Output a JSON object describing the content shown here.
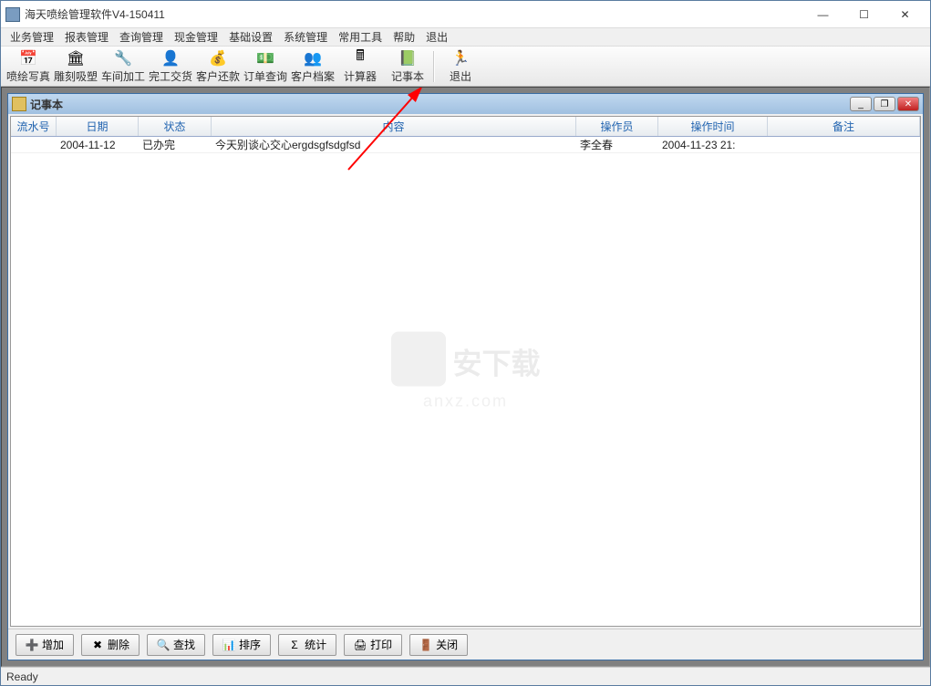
{
  "window": {
    "title": "海天喷绘管理软件V4-150411"
  },
  "menu": {
    "items": [
      "业务管理",
      "报表管理",
      "查询管理",
      "现金管理",
      "基础设置",
      "系统管理",
      "常用工具",
      "帮助",
      "退出"
    ]
  },
  "toolbar": {
    "items": [
      {
        "label": "喷绘写真",
        "icon": "📅"
      },
      {
        "label": "雕刻吸塑",
        "icon": "🏛"
      },
      {
        "label": "车间加工",
        "icon": "🔧"
      },
      {
        "label": "完工交货",
        "icon": "👤"
      },
      {
        "label": "客户还款",
        "icon": "💰"
      },
      {
        "label": "订单查询",
        "icon": "💵"
      },
      {
        "label": "客户档案",
        "icon": "👥"
      },
      {
        "label": "计算器",
        "icon": "🖩"
      },
      {
        "label": "记事本",
        "icon": "📗"
      },
      {
        "label": "退出",
        "icon": "🏃"
      }
    ]
  },
  "child": {
    "title": "记事本",
    "columns": [
      "流水号",
      "日期",
      "状态",
      "内容",
      "操作员",
      "操作时间",
      "备注"
    ],
    "rows": [
      {
        "id": "",
        "date": "2004-11-12",
        "status": "已办完",
        "content": "今天别谈心交心ergdsgfsdgfsd",
        "operator": "李全春",
        "time": "2004-11-23 21:",
        "remark": ""
      }
    ],
    "actions": [
      {
        "label": "增加",
        "icon": "➕"
      },
      {
        "label": "删除",
        "icon": "✖"
      },
      {
        "label": "查找",
        "icon": "🔍"
      },
      {
        "label": "排序",
        "icon": "📊"
      },
      {
        "label": "统计",
        "icon": "Σ"
      },
      {
        "label": "打印",
        "icon": "🖨"
      },
      {
        "label": "关闭",
        "icon": "🚪"
      }
    ]
  },
  "watermark": {
    "text": "安下载",
    "sub": "anxz.com"
  },
  "status": {
    "text": "Ready"
  }
}
